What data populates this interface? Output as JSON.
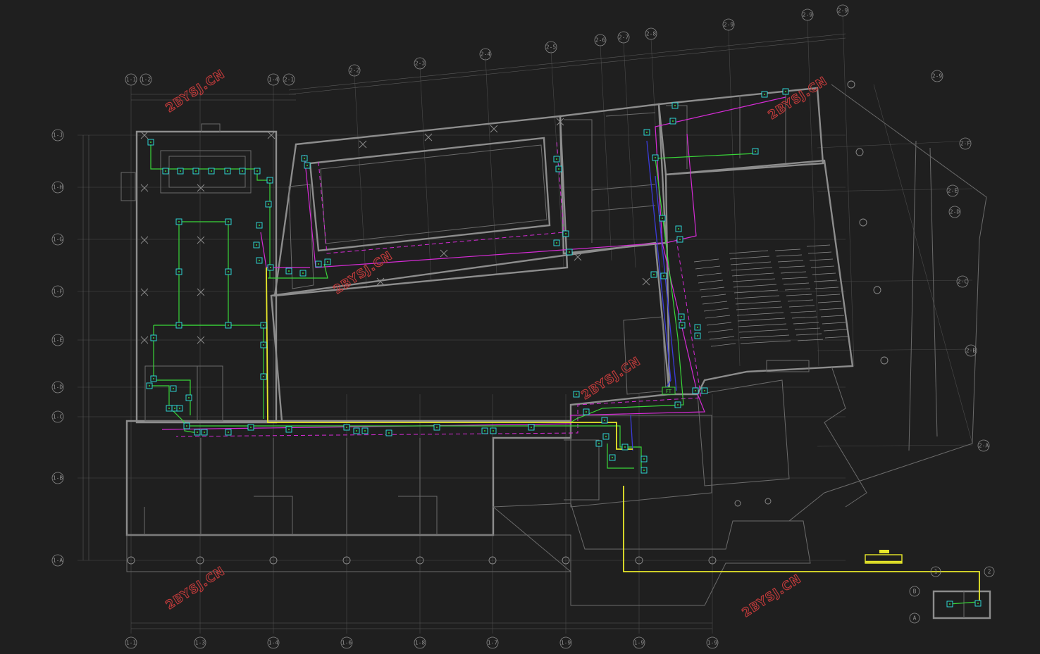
{
  "watermark_text": "2BYSJ.CN",
  "colors": {
    "background": "#1f1f1f",
    "walls": "#8d8d8d",
    "cable_magenta": "#d62bd6",
    "cable_green": "#39d639",
    "cable_yellow": "#e8e82a",
    "cable_blue": "#3b3bd9",
    "devices": "#2ee6e6",
    "watermark": "#c23b3b"
  },
  "left_axis_labels": [
    "1-J",
    "1-H",
    "1-G",
    "1-F",
    "1-E",
    "1-D",
    "1-C",
    "1-B",
    "1-A"
  ],
  "bottom_axis_labels": [
    "1-1",
    "1-3",
    "1-4",
    "1-6",
    "1-8",
    "1-7",
    "1-9",
    "1-9",
    "1-9"
  ],
  "top_left_axis_labels": [
    "1-1",
    "1-2",
    "1-4",
    "2-1"
  ],
  "top_axis_labels": [
    "2-2",
    "2-3",
    "2-4",
    "2-5",
    "2-6",
    "2-7",
    "2-8",
    "2-9",
    "2-9",
    "2-9",
    "2-9"
  ],
  "right_axis_labels": [
    "2-F",
    "2-E",
    "2-D",
    "2-C",
    "2-B",
    "2-A"
  ],
  "inset_labels": [
    "1",
    "2",
    "B",
    "A"
  ],
  "legend_text": "FT"
}
